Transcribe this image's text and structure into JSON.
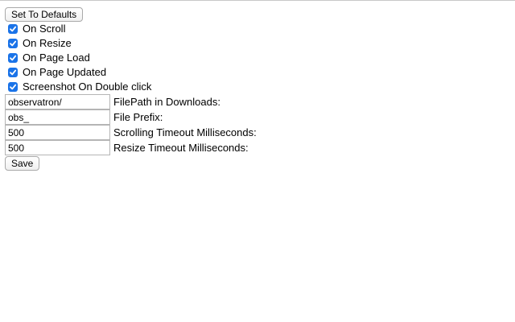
{
  "buttons": {
    "defaults_label": "Set To Defaults",
    "save_label": "Save"
  },
  "checkboxes": [
    {
      "label": "On Scroll",
      "checked": true
    },
    {
      "label": "On Resize",
      "checked": true
    },
    {
      "label": "On Page Load",
      "checked": true
    },
    {
      "label": "On Page Updated",
      "checked": true
    },
    {
      "label": "Screenshot On Double click",
      "checked": true
    }
  ],
  "fields": [
    {
      "value": "observatron/",
      "label": "FilePath in Downloads:"
    },
    {
      "value": "obs_",
      "label": "File Prefix:"
    },
    {
      "value": "500",
      "label": "Scrolling Timeout Milliseconds:"
    },
    {
      "value": "500",
      "label": "Resize Timeout Milliseconds:"
    }
  ],
  "colors": {
    "checkbox_accent": "#1a73e8"
  }
}
